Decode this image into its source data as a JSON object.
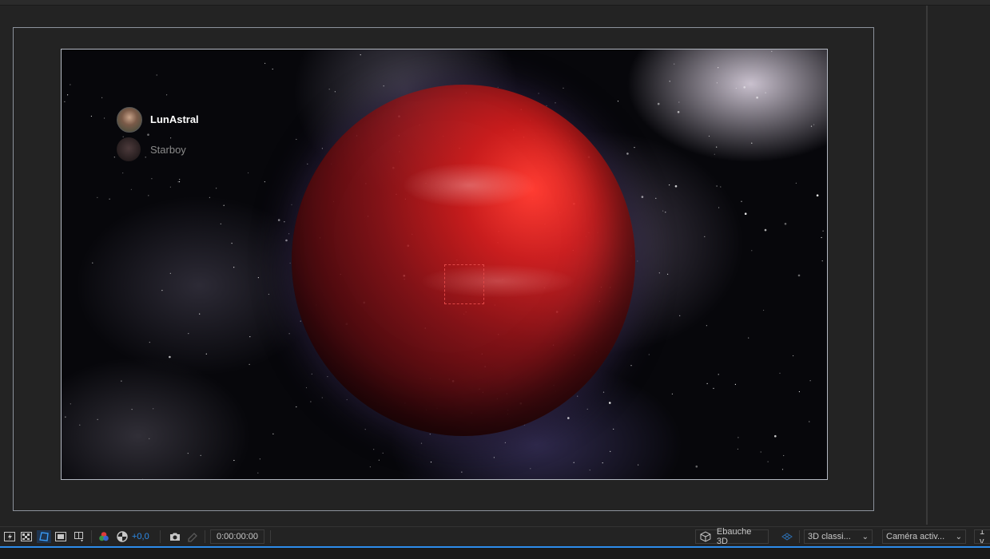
{
  "composition": {
    "users": [
      {
        "name": "LunAstral",
        "active": true
      },
      {
        "name": "Starboy",
        "active": false
      }
    ]
  },
  "toolbar": {
    "exposure_value": "+0,0",
    "timecode": "0:00:00:00",
    "renderer_label": "Ebauche 3D",
    "renderer_mode": "3D  classi...",
    "camera": "Caméra activ...",
    "views_partial": "1 v"
  },
  "colors": {
    "accent": "#2d8ceb",
    "anchor": "#e04848",
    "background": "#232323"
  },
  "icons": [
    "fast-previews-icon",
    "transparency-grid-icon",
    "mask-path-icon",
    "region-of-interest-icon",
    "toggle-view-icon",
    "channel-icon",
    "reset-exposure-icon",
    "snapshot-icon",
    "show-snapshot-icon",
    "draft-3d-icon",
    "grid-view-icon"
  ]
}
